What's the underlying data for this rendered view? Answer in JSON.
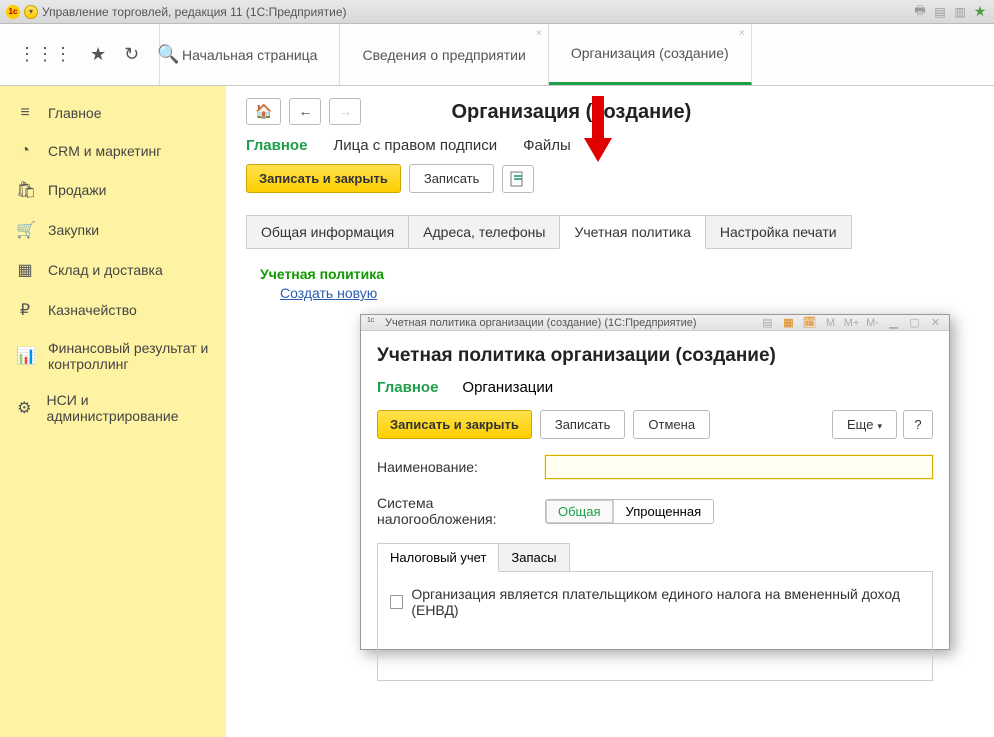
{
  "titlebar": {
    "text": "Управление торговлей, редакция 11  (1С:Предприятие)"
  },
  "topTabs": {
    "home": "Начальная страница",
    "about": "Сведения о предприятии",
    "org": "Организация (создание)"
  },
  "sidebar": {
    "items": [
      {
        "icon": "≡",
        "label": "Главное"
      },
      {
        "icon": "◔",
        "label": "CRM и маркетинг"
      },
      {
        "icon": "🛍",
        "label": "Продажи"
      },
      {
        "icon": "🛒",
        "label": "Закупки"
      },
      {
        "icon": "▦",
        "label": "Склад и доставка"
      },
      {
        "icon": "₽",
        "label": "Казначейство"
      },
      {
        "icon": "📊",
        "label": "Финансовый результат и контроллинг"
      },
      {
        "icon": "⚙",
        "label": "НСИ и администрирование"
      }
    ]
  },
  "page": {
    "title": "Организация (создание)",
    "subnav": {
      "main": "Главное",
      "signers": "Лица с правом подписи",
      "files": "Файлы"
    },
    "actions": {
      "saveClose": "Записать и закрыть",
      "save": "Записать"
    },
    "tabs": {
      "general": "Общая информация",
      "addresses": "Адреса, телефоны",
      "policy": "Учетная политика",
      "print": "Настройка печати"
    },
    "section": {
      "title": "Учетная политика",
      "createLink": "Создать новую"
    }
  },
  "dialog": {
    "title": "Учетная политика организации (создание)  (1С:Предприятие)",
    "heading": "Учетная политика организации (создание)",
    "subnav": {
      "main": "Главное",
      "orgs": "Организации"
    },
    "actions": {
      "saveClose": "Записать и закрыть",
      "save": "Записать",
      "cancel": "Отмена",
      "more": "Еще",
      "help": "?"
    },
    "form": {
      "nameLabel": "Наименование:",
      "nameValue": "",
      "taxLabel": "Система налогообложения:",
      "taxGeneral": "Общая",
      "taxSimplified": "Упрощенная"
    },
    "innerTabs": {
      "taxAcc": "Налоговый учет",
      "stock": "Запасы"
    },
    "checkbox": "Организация является плательщиком единого налога на вмененный доход (ЕНВД)"
  }
}
